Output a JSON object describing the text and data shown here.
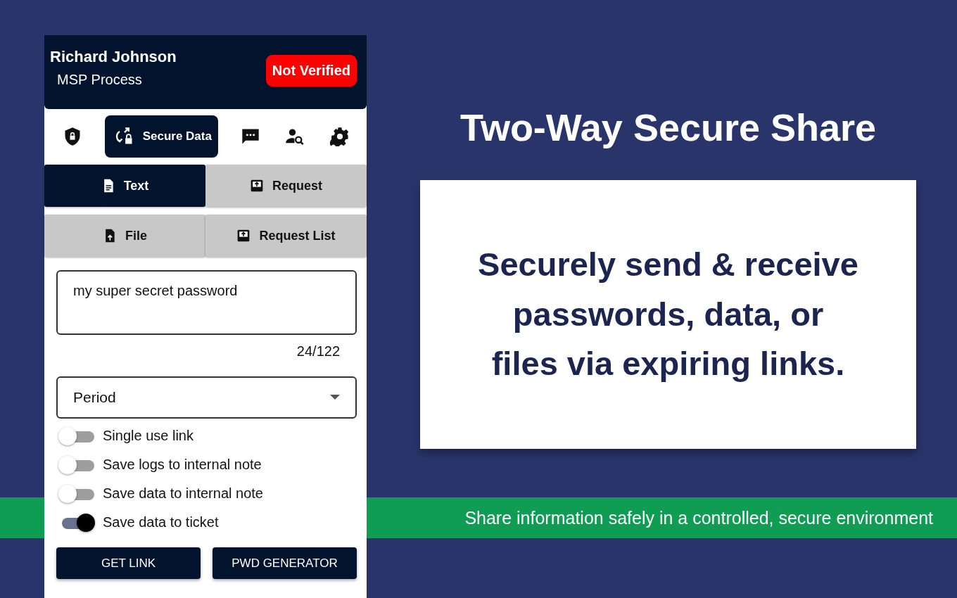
{
  "profile": {
    "name": "Richard Johnson",
    "subtitle": "MSP Process",
    "badge": "Not Verified"
  },
  "nav": [
    {
      "kind": "shield",
      "selected": false
    },
    {
      "kind": "sync-lock",
      "label": "Secure Data",
      "selected": true
    },
    {
      "kind": "chat",
      "selected": false
    },
    {
      "kind": "user-search",
      "selected": false
    },
    {
      "kind": "gear",
      "selected": false
    }
  ],
  "modes": [
    {
      "kind": "text",
      "label": "Text",
      "selected": true
    },
    {
      "kind": "request",
      "label": "Request",
      "selected": false
    },
    {
      "kind": "file",
      "label": "File",
      "selected": false
    },
    {
      "kind": "request",
      "label": "Request List",
      "selected": false
    }
  ],
  "message": {
    "value": "my super secret password",
    "counter": "24/122"
  },
  "period": {
    "placeholder": "Period"
  },
  "toggles": [
    {
      "label": "Single use link",
      "on": false
    },
    {
      "label": "Save logs to internal note",
      "on": false
    },
    {
      "label": "Save data to internal note",
      "on": false
    },
    {
      "label": "Save data to ticket",
      "on": true
    }
  ],
  "buttons": [
    "GET LINK",
    "PWD GENERATOR"
  ],
  "headline": "Two-Way Secure Share",
  "card_text": "Securely send & receive\npasswords, data, or\nfiles via expiring links.",
  "banner": "Share information safely in a controlled, secure environment"
}
